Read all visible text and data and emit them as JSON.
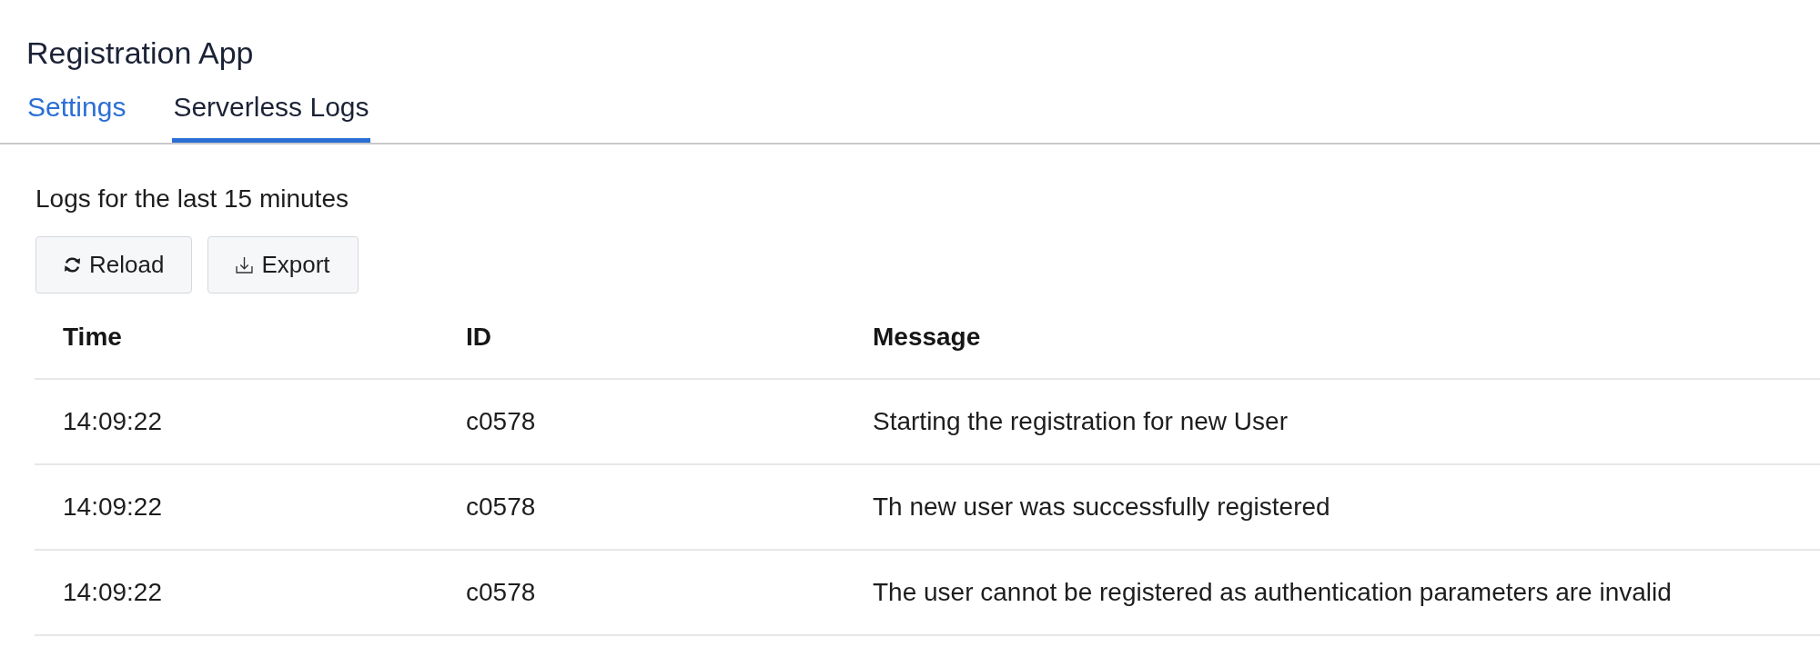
{
  "app": {
    "title": "Registration App"
  },
  "tabs": [
    {
      "label": "Settings",
      "selected": false
    },
    {
      "label": "Serverless Logs",
      "selected": true
    }
  ],
  "logs": {
    "caption": "Logs for the last 15 minutes",
    "buttons": [
      {
        "label": "Reload",
        "kind": "reload"
      },
      {
        "label": "Export",
        "kind": "export"
      }
    ]
  },
  "table": {
    "columns": [
      "Time",
      "ID",
      "Message"
    ],
    "rows": [
      [
        "14:09:22",
        "c0578",
        "Starting the registration for new User"
      ],
      [
        "14:09:22",
        "c0578",
        "Th new user was successfully registered"
      ],
      [
        "14:09:22",
        "c0578",
        "The user cannot be registered as authentication parameters are invalid"
      ]
    ]
  }
}
